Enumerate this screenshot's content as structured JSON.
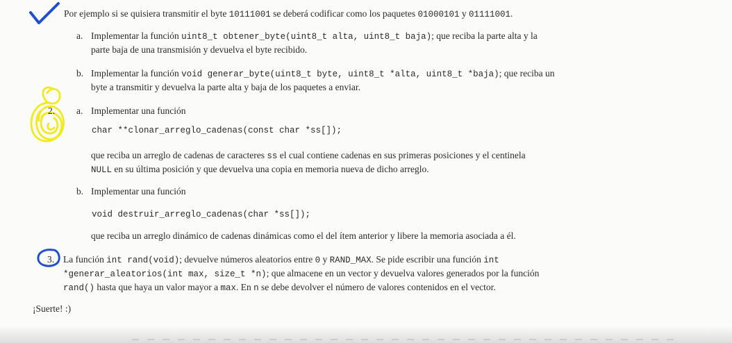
{
  "intro": {
    "before": "Por ejemplo si se quisiera transmitir el byte ",
    "byte": "10111001",
    "middle": " se deberá codificar como los paquetes ",
    "pkt1": "01000101",
    "and": " y ",
    "pkt2": "01111001",
    "end": "."
  },
  "ex1": {
    "a": {
      "letter": "a.",
      "l1_before": "Implementar la función ",
      "l1_code": "uint8_t obtener_byte(uint8_t alta, uint8_t baja)",
      "l1_after": "; que reciba la parte alta y la",
      "l2": "parte baja de una transmisión y devuelva el byte recibido."
    },
    "b": {
      "letter": "b.",
      "l1_before": "Implementar la función ",
      "l1_code": "void generar_byte(uint8_t byte, uint8_t *alta, uint8_t *baja)",
      "l1_after": "; que reciba un",
      "l2": "byte a transmitir y devuelva la parte alta y baja de los paquetes a enviar."
    }
  },
  "ex2": {
    "number": "2.",
    "a": {
      "letter": "a.",
      "intro": "Implementar una función",
      "code": "char **clonar_arreglo_cadenas(const char *ss[]);",
      "l1_before": "que reciba un arreglo de cadenas de caracteres ",
      "l1_code": "ss",
      "l1_after": " el cual contiene cadenas en sus primeras posiciones y el centinela",
      "l2_code": "NULL",
      "l2_after": " en su última posición y que devuelva una copia en memoria nueva de dicho arreglo."
    },
    "b": {
      "letter": "b.",
      "intro": "Implementar una función",
      "code": "void destruir_arreglo_cadenas(char *ss[]);",
      "desc": "que reciba un arreglo dinámico de cadenas dinámicas como el del ítem anterior y libere la memoria asociada a él."
    }
  },
  "ex3": {
    "number": "3.",
    "l1_t1": "La función ",
    "l1_c1": "int rand(void)",
    "l1_t2": "; devuelve números aleatorios entre ",
    "l1_c2": "0",
    "l1_t3": " y ",
    "l1_c3": "RAND_MAX",
    "l1_t4": ". Se pide escribir una función ",
    "l1_c4": "int",
    "l2_c1": "*generar_aleatorios(int max, size_t *n)",
    "l2_t1": "; que almacene en un vector y devuelva valores generados por la función",
    "l3_c1": "rand()",
    "l3_t1": " hasta que haya un valor mayor a ",
    "l3_c2": "max",
    "l3_t2": ". En ",
    "l3_c3": "n",
    "l3_t3": " se debe devolver el número de valores contenidos en el vector."
  },
  "closing": "¡Suerte! :)",
  "annotations": {
    "check_color": "#1f4fd0",
    "ex2_circle_color": "#f2ea1c",
    "ex3_circle_color": "#1f4fd0",
    "icons": [
      "checkmark-icon",
      "scribble-circle-icon",
      "pen-circle-icon"
    ]
  }
}
